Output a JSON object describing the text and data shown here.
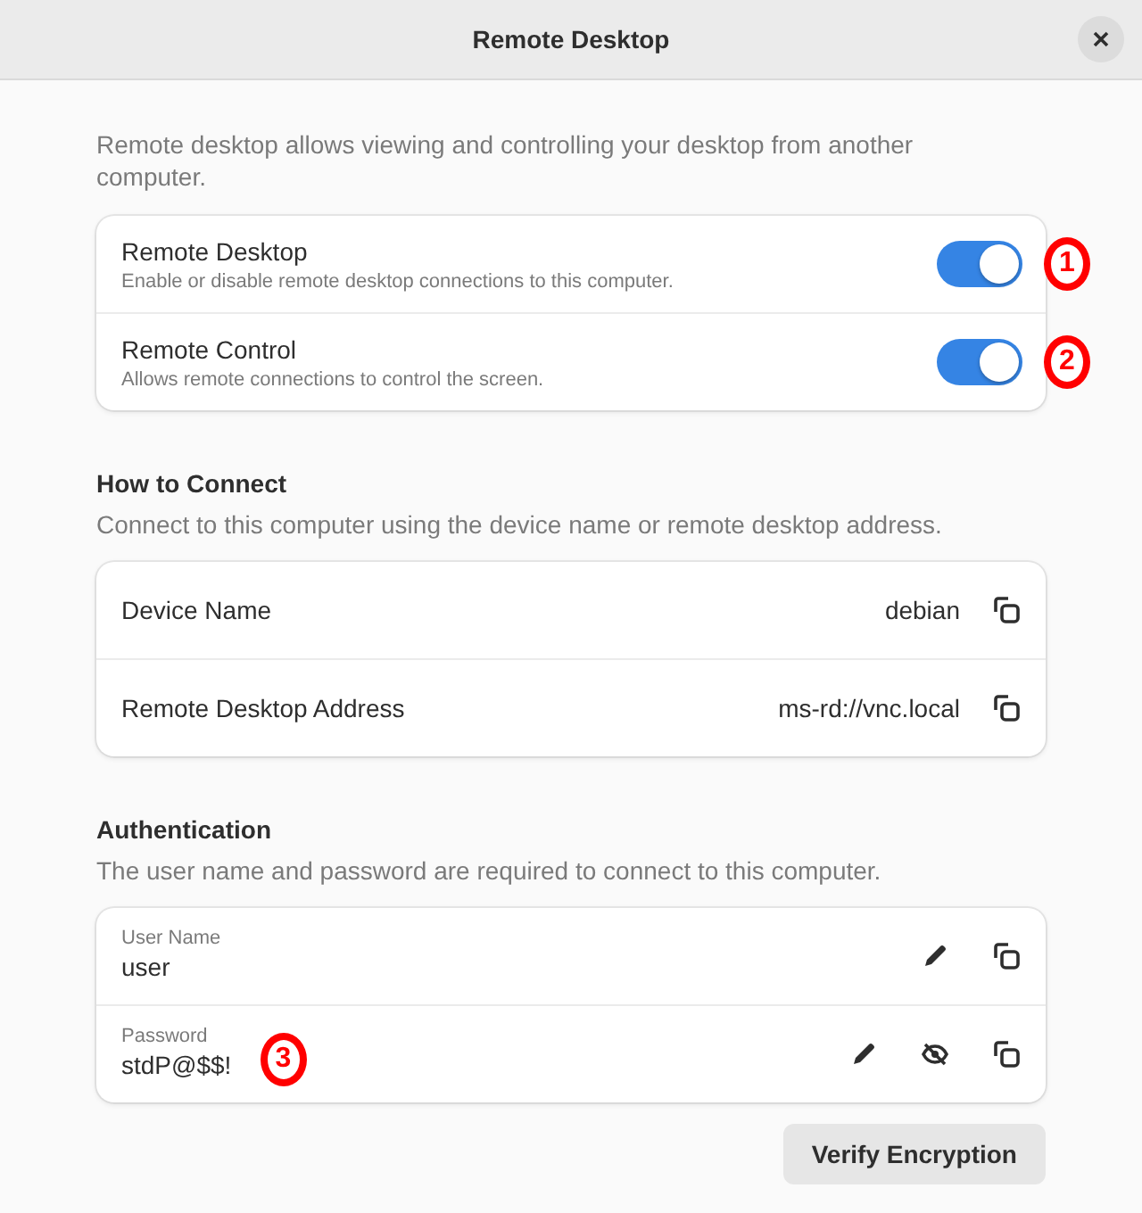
{
  "window": {
    "title": "Remote Desktop"
  },
  "intro": "Remote desktop allows viewing and controlling your desktop from another computer.",
  "switches": [
    {
      "title": "Remote Desktop",
      "subtitle": "Enable or disable remote desktop connections to this computer.",
      "on": true,
      "callout": "1"
    },
    {
      "title": "Remote Control",
      "subtitle": "Allows remote connections to control the screen.",
      "on": true,
      "callout": "2"
    }
  ],
  "connect": {
    "heading": "How to Connect",
    "description": "Connect to this computer using the device name or remote desktop address.",
    "rows": [
      {
        "label": "Device Name",
        "value": "debian"
      },
      {
        "label": "Remote Desktop Address",
        "value": "ms-rd://vnc.local"
      }
    ]
  },
  "auth": {
    "heading": "Authentication",
    "description": "The user name and password are required to connect to this computer.",
    "fields": [
      {
        "label": "User Name",
        "value": "user",
        "actions": [
          {
            "kind": "edit"
          },
          {
            "kind": "copy"
          }
        ]
      },
      {
        "label": "Password",
        "value": "stdP@$$!",
        "callout": "3",
        "actions": [
          {
            "kind": "edit"
          },
          {
            "kind": "reveal"
          },
          {
            "kind": "copy"
          }
        ]
      }
    ]
  },
  "buttons": [
    "Verify Encryption"
  ]
}
